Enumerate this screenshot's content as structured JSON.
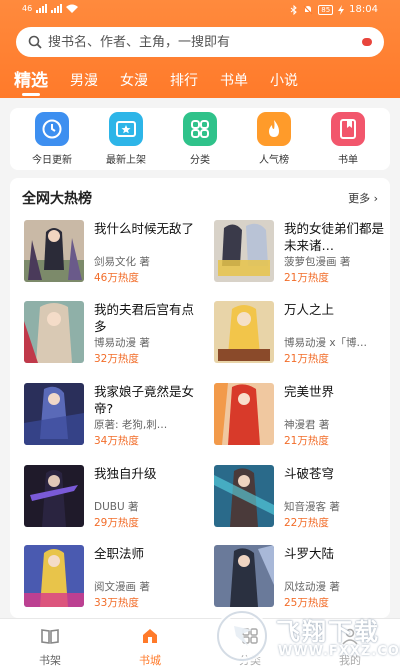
{
  "colors": {
    "accent": "#ff7a2a",
    "heat": "#f26d2a"
  },
  "status": {
    "time": "18:04",
    "battery": "85",
    "carrier": "46"
  },
  "search": {
    "placeholder": "搜书名、作者、主角，一搜即有"
  },
  "tabs": [
    "精选",
    "男漫",
    "女漫",
    "排行",
    "书单",
    "小说"
  ],
  "quick": [
    {
      "label": "今日更新",
      "icon": "clock-icon",
      "color": "#3d8ff0"
    },
    {
      "label": "最新上架",
      "icon": "star-box-icon",
      "color": "#2db5e8"
    },
    {
      "label": "分类",
      "icon": "grid-icon",
      "color": "#2fc28a"
    },
    {
      "label": "人气榜",
      "icon": "flame-icon",
      "color": "#ff9b2a"
    },
    {
      "label": "书单",
      "icon": "bookmark-book-icon",
      "color": "#f2566c"
    }
  ],
  "section": {
    "title": "全网大热榜",
    "more": "更多"
  },
  "books": [
    {
      "title": "我什么时候无敌了",
      "author": "剑易文化 著",
      "heat": "46万热度"
    },
    {
      "title": "我的女徒弟们都是未来诸…",
      "author": "菠萝包漫画 著",
      "heat": "21万热度"
    },
    {
      "title": "我的夫君后宫有点多",
      "author": "博易动漫 著",
      "heat": "32万热度"
    },
    {
      "title": "万人之上",
      "author": "博易动漫 x「博…",
      "heat": "21万热度"
    },
    {
      "title": "我家娘子竟然是女帝?",
      "author": "原著: 老狗,刺…",
      "heat": "34万热度"
    },
    {
      "title": "完美世界",
      "author": "神漫君 著",
      "heat": "21万热度"
    },
    {
      "title": "我独自升级",
      "author": "DUBU 著",
      "heat": "29万热度"
    },
    {
      "title": "斗破苍穹",
      "author": "知音漫客 著",
      "heat": "22万热度"
    },
    {
      "title": "全职法师",
      "author": "阅文漫画 著",
      "heat": "33万热度"
    },
    {
      "title": "斗罗大陆",
      "author": "风炫动漫 著",
      "heat": "25万热度"
    }
  ],
  "tabbar": [
    {
      "label": "书架",
      "icon": "book-open-icon",
      "active": false
    },
    {
      "label": "书城",
      "icon": "home-icon",
      "active": true
    },
    {
      "label": "分类",
      "icon": "grid-icon",
      "active": false
    },
    {
      "label": "我的",
      "icon": "user-icon",
      "active": false
    }
  ],
  "watermark": {
    "text": "飞翔下载",
    "url": "WWW.FXXZ.COM"
  }
}
